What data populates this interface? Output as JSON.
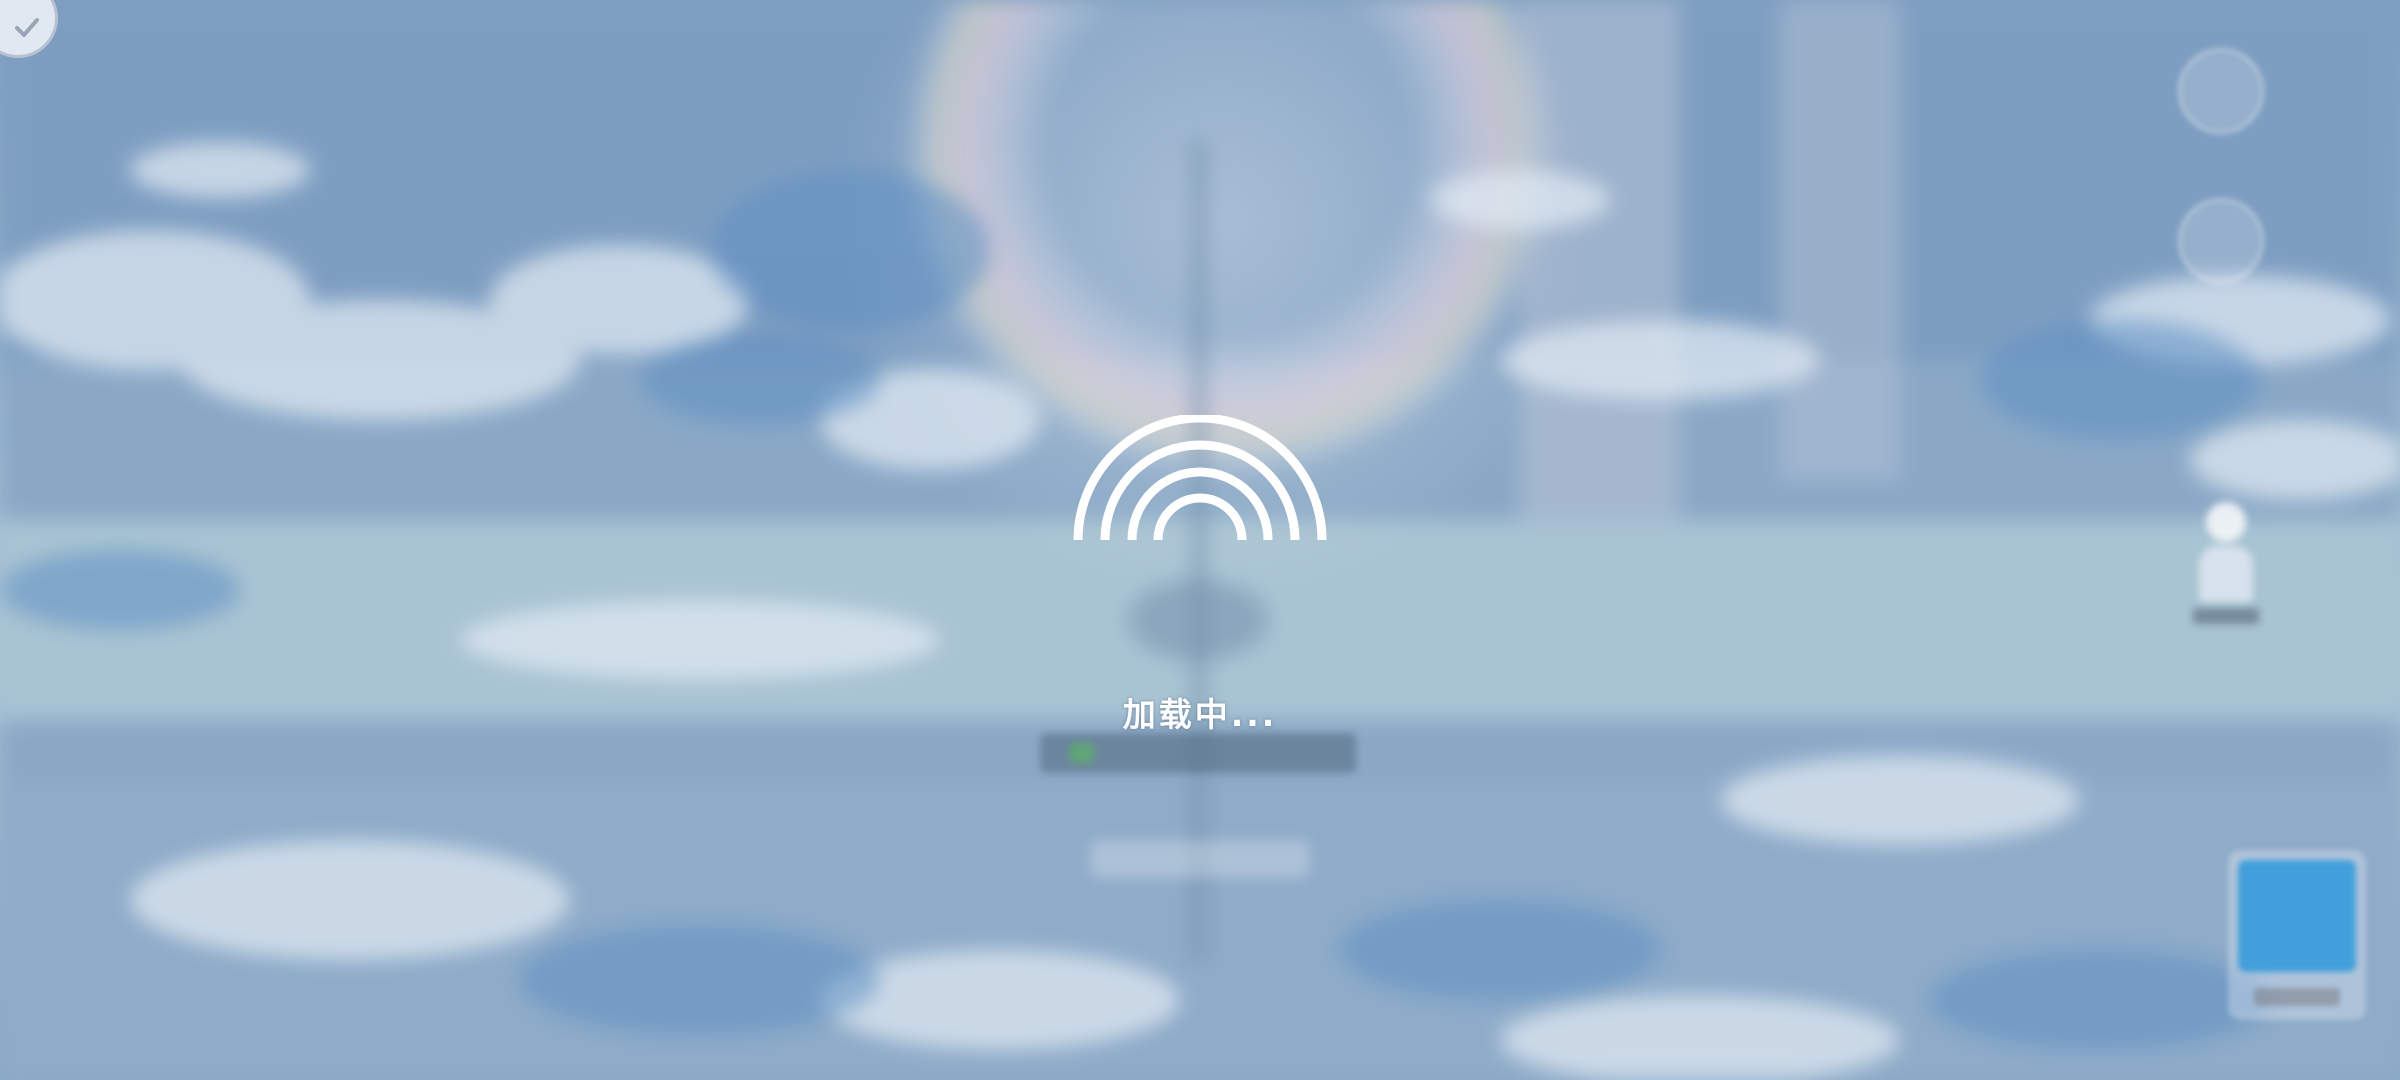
{
  "loading": {
    "status_text": "加载中..."
  },
  "colors": {
    "sky_top": "#7f9fc0",
    "sky_mid": "#a4c0d2",
    "loader_stroke": "#ffffff",
    "accent_blue": "#2896dc"
  },
  "icons": {
    "corner": "check-badge-icon",
    "side_top": "lantern-icon",
    "side_mid": "compass-icon",
    "loader": "signal-arcs-icon"
  }
}
